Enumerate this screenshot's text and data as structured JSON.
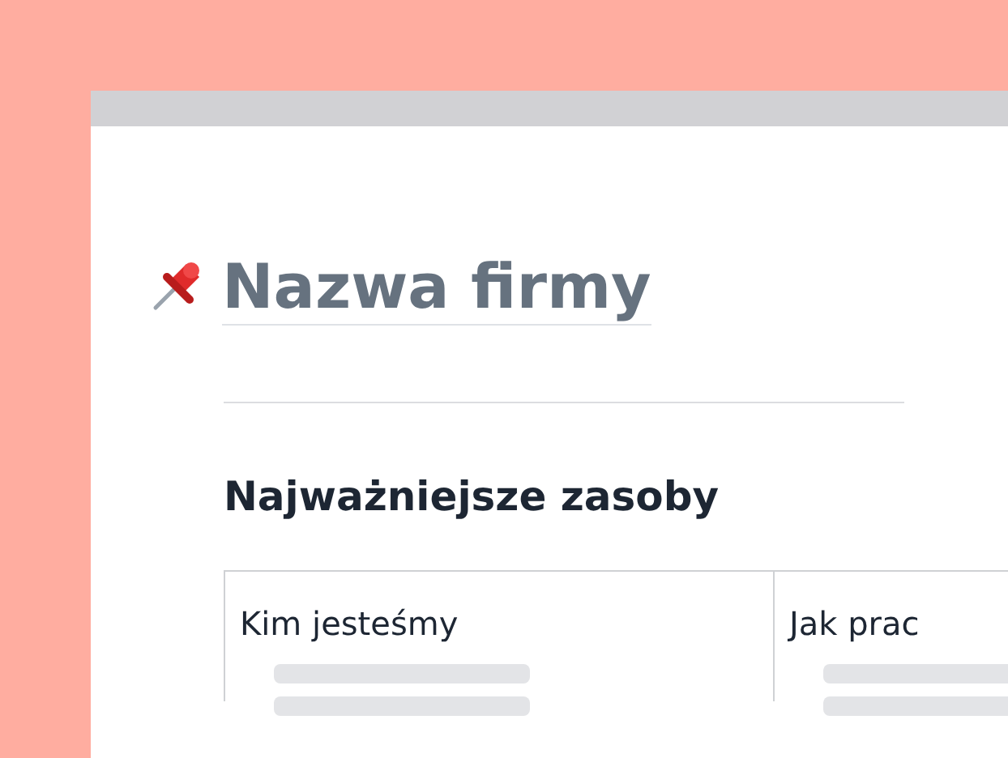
{
  "page": {
    "title": "Nazwa firmy"
  },
  "section": {
    "heading": "Najważniejsze zasoby"
  },
  "cards": [
    {
      "title": "Kim jesteśmy"
    },
    {
      "title": "Jak prac"
    }
  ]
}
